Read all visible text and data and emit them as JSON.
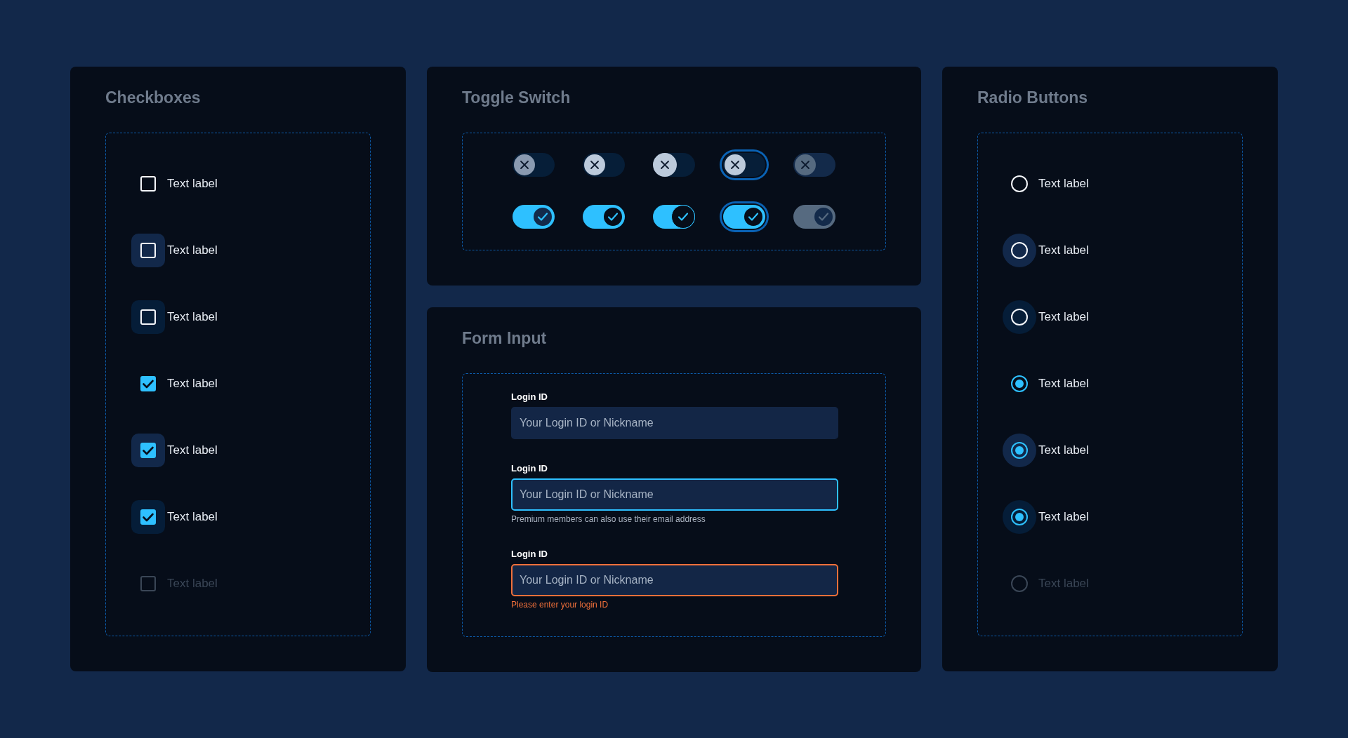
{
  "checkboxes": {
    "title": "Checkboxes",
    "items": [
      {
        "label": "Text label",
        "checked": false,
        "kind": "default"
      },
      {
        "label": "Text label",
        "checked": false,
        "kind": "hover"
      },
      {
        "label": "Text label",
        "checked": false,
        "kind": "pressed"
      },
      {
        "label": "Text label",
        "checked": true,
        "kind": "default"
      },
      {
        "label": "Text label",
        "checked": true,
        "kind": "hover"
      },
      {
        "label": "Text label",
        "checked": true,
        "kind": "pressed"
      },
      {
        "label": "Text label",
        "checked": false,
        "kind": "disabled"
      }
    ]
  },
  "toggle_switch": {
    "title": "Toggle Switch",
    "rows": [
      {
        "switches": [
          {
            "on": false,
            "kind": "default"
          },
          {
            "on": false,
            "kind": "hover"
          },
          {
            "on": false,
            "kind": "pressed"
          },
          {
            "on": false,
            "kind": "focused"
          },
          {
            "on": false,
            "kind": "disabled"
          }
        ]
      },
      {
        "switches": [
          {
            "on": true,
            "kind": "default"
          },
          {
            "on": true,
            "kind": "hover"
          },
          {
            "on": true,
            "kind": "pressed"
          },
          {
            "on": true,
            "kind": "focused"
          },
          {
            "on": true,
            "kind": "disabled"
          }
        ]
      }
    ]
  },
  "form_input": {
    "title": "Form Input",
    "fields": [
      {
        "label": "Login ID",
        "placeholder": "Your Login ID or Nickname",
        "kind": "default"
      },
      {
        "label": "Login ID",
        "placeholder": "Your Login ID or Nickname",
        "kind": "focused",
        "message": "Premium members can also use their email address"
      },
      {
        "label": "Login ID",
        "placeholder": "Your Login ID or Nickname",
        "kind": "error",
        "message": "Please enter your login ID"
      }
    ]
  },
  "radio_buttons": {
    "title": "Radio Buttons",
    "items": [
      {
        "label": "Text label",
        "selected": false,
        "kind": "default"
      },
      {
        "label": "Text label",
        "selected": false,
        "kind": "hover"
      },
      {
        "label": "Text label",
        "selected": false,
        "kind": "pressed"
      },
      {
        "label": "Text label",
        "selected": true,
        "kind": "default"
      },
      {
        "label": "Text label",
        "selected": true,
        "kind": "hover"
      },
      {
        "label": "Text label",
        "selected": true,
        "kind": "pressed"
      },
      {
        "label": "Text label",
        "selected": false,
        "kind": "disabled"
      }
    ]
  }
}
